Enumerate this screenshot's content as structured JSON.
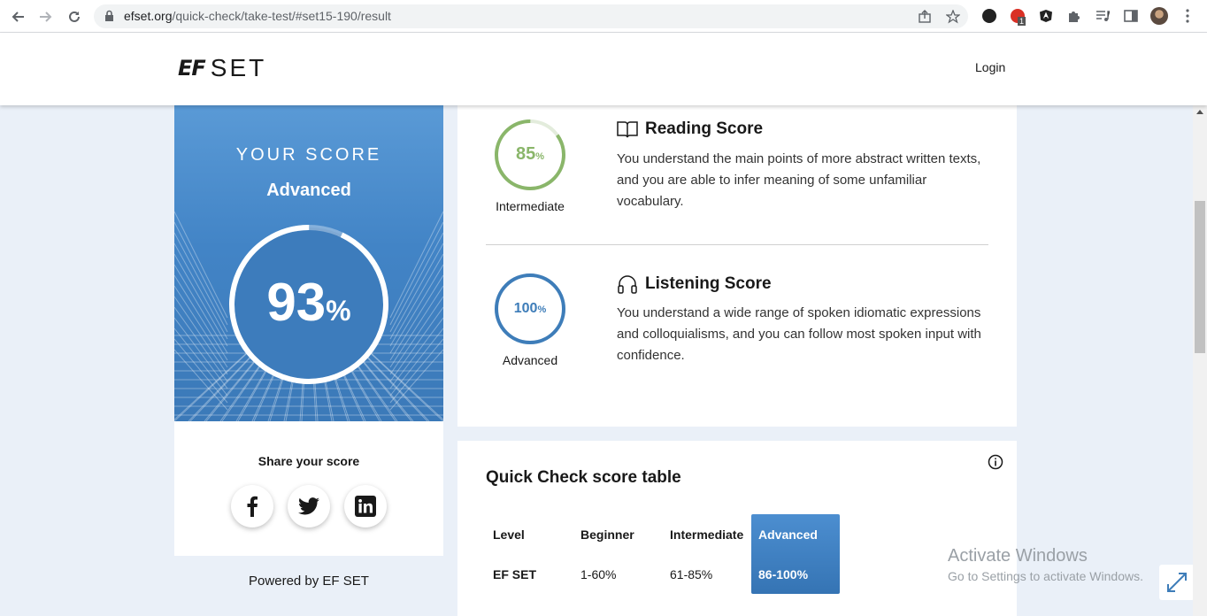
{
  "browser": {
    "url_host": "efset.org",
    "url_path": "/quick-check/take-test/#set15-190/result",
    "extension_badge": "1"
  },
  "header": {
    "logo_ef": "EF",
    "logo_set": "SET",
    "login_label": "Login"
  },
  "score": {
    "heading": "YOUR SCORE",
    "level": "Advanced",
    "value": "93",
    "unit": "%",
    "fraction": 0.93
  },
  "share": {
    "title": "Share your score",
    "networks": [
      "facebook",
      "twitter",
      "linkedin"
    ]
  },
  "powered_by": "Powered by EF SET",
  "skills": [
    {
      "title": "Reading Score",
      "icon": "book-icon",
      "value": "85",
      "unit": "%",
      "fraction": 0.85,
      "level": "Intermediate",
      "color": "#8ab66a",
      "description": "You understand the main points of more abstract written texts, and you are able to infer meaning of some unfamiliar vocabulary."
    },
    {
      "title": "Listening Score",
      "icon": "headphones-icon",
      "value": "100",
      "unit": "%",
      "fraction": 1.0,
      "level": "Advanced",
      "color": "#3e7db9",
      "description": "You understand a wide range of spoken idiomatic expressions and colloquialisms, and you can follow most spoken input with confidence."
    }
  ],
  "score_table": {
    "title": "Quick Check score table",
    "headers": [
      "Level",
      "Beginner",
      "Intermediate",
      "Advanced"
    ],
    "row": [
      "EF SET",
      "1-60%",
      "61-85%",
      "86-100%"
    ],
    "highlight_color": "#3f80c2"
  },
  "watermark": {
    "line1": "Activate Windows",
    "line2": "Go to Settings to activate Windows."
  }
}
